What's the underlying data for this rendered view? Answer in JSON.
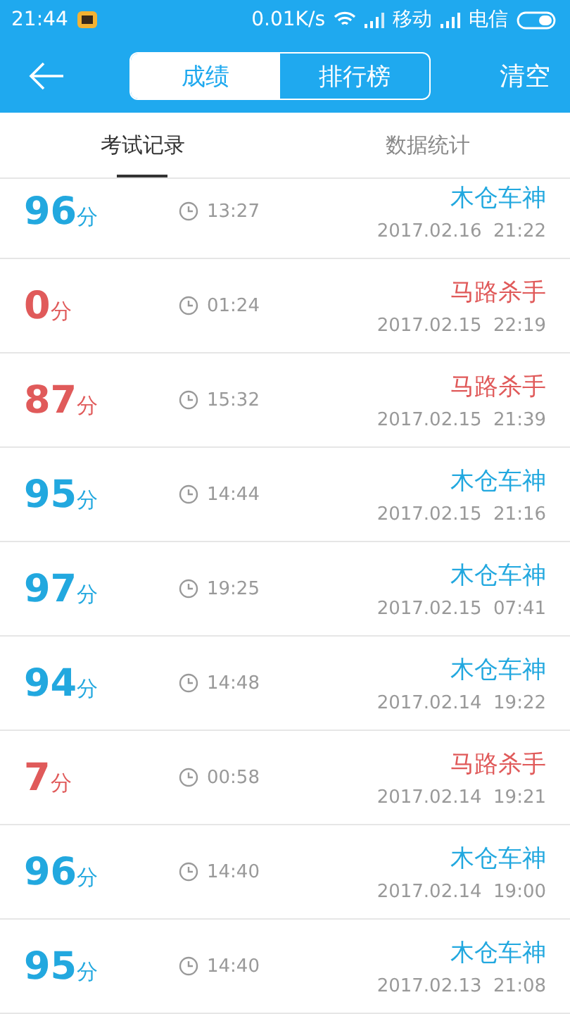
{
  "status_bar": {
    "time": "21:44",
    "speed": "0.01K/s",
    "carrier_1": "移动",
    "carrier_2": "电信"
  },
  "header": {
    "segments": [
      {
        "label": "成绩",
        "selected": true
      },
      {
        "label": "排行榜",
        "selected": false
      }
    ],
    "action": "清空"
  },
  "tabs": [
    {
      "label": "考试记录",
      "selected": true
    },
    {
      "label": "数据统计",
      "selected": false
    }
  ],
  "records": [
    {
      "score": "96",
      "unit": "分",
      "duration": "13:27",
      "title": "木仓车神",
      "date": "2017.02.16  21:22",
      "color": "#22a8df"
    },
    {
      "score": "0",
      "unit": "分",
      "duration": "01:24",
      "title": "马路杀手",
      "date": "2017.02.15  22:19",
      "color": "#e05a5a"
    },
    {
      "score": "87",
      "unit": "分",
      "duration": "15:32",
      "title": "马路杀手",
      "date": "2017.02.15  21:39",
      "color": "#e05a5a"
    },
    {
      "score": "95",
      "unit": "分",
      "duration": "14:44",
      "title": "木仓车神",
      "date": "2017.02.15  21:16",
      "color": "#22a8df"
    },
    {
      "score": "97",
      "unit": "分",
      "duration": "19:25",
      "title": "木仓车神",
      "date": "2017.02.15  07:41",
      "color": "#22a8df"
    },
    {
      "score": "94",
      "unit": "分",
      "duration": "14:48",
      "title": "木仓车神",
      "date": "2017.02.14  19:22",
      "color": "#22a8df"
    },
    {
      "score": "7",
      "unit": "分",
      "duration": "00:58",
      "title": "马路杀手",
      "date": "2017.02.14  19:21",
      "color": "#e05a5a"
    },
    {
      "score": "96",
      "unit": "分",
      "duration": "14:40",
      "title": "木仓车神",
      "date": "2017.02.14  19:00",
      "color": "#22a8df"
    },
    {
      "score": "95",
      "unit": "分",
      "duration": "14:40",
      "title": "木仓车神",
      "date": "2017.02.13  21:08",
      "color": "#22a8df"
    }
  ]
}
